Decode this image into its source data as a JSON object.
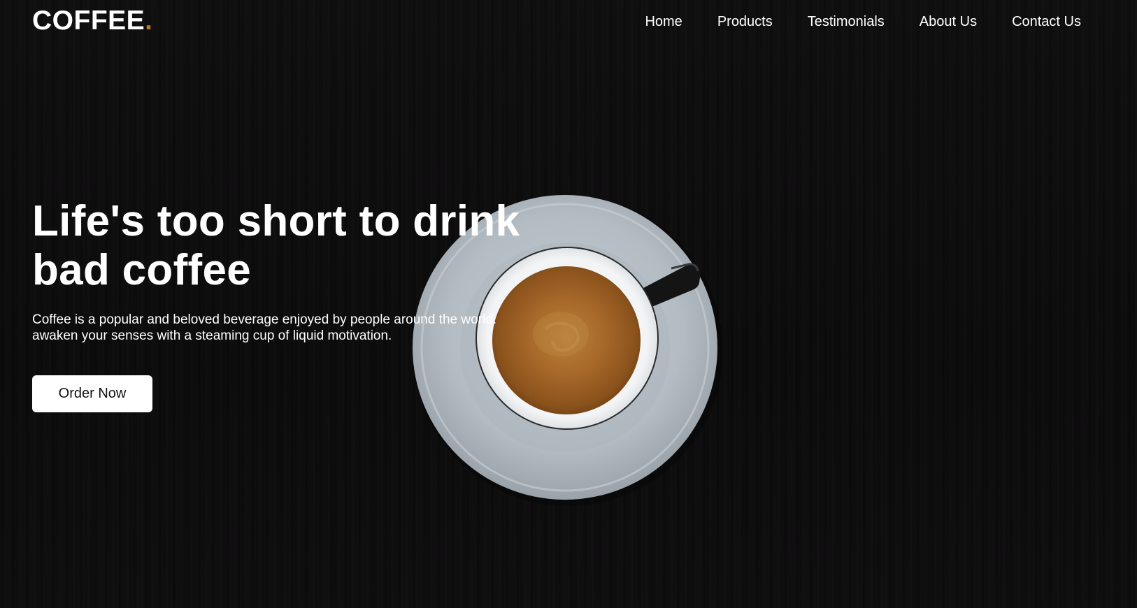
{
  "brand": {
    "name": "COFFEE",
    "dot": ".",
    "accent_color": "#c0742f"
  },
  "nav": {
    "items": [
      {
        "label": "Home"
      },
      {
        "label": "Products"
      },
      {
        "label": "Testimonials"
      },
      {
        "label": "About Us"
      },
      {
        "label": "Contact Us"
      }
    ]
  },
  "hero": {
    "headline": "Life's too short to drink bad coffee",
    "subtitle_line1": "Coffee is a popular and beloved beverage enjoyed by people around the world.",
    "subtitle_line2": "awaken your senses with a steaming cup of liquid motivation.",
    "cta_label": "Order Now",
    "background_color": "#0d0c0d",
    "image": "coffee-cup-on-saucer"
  }
}
